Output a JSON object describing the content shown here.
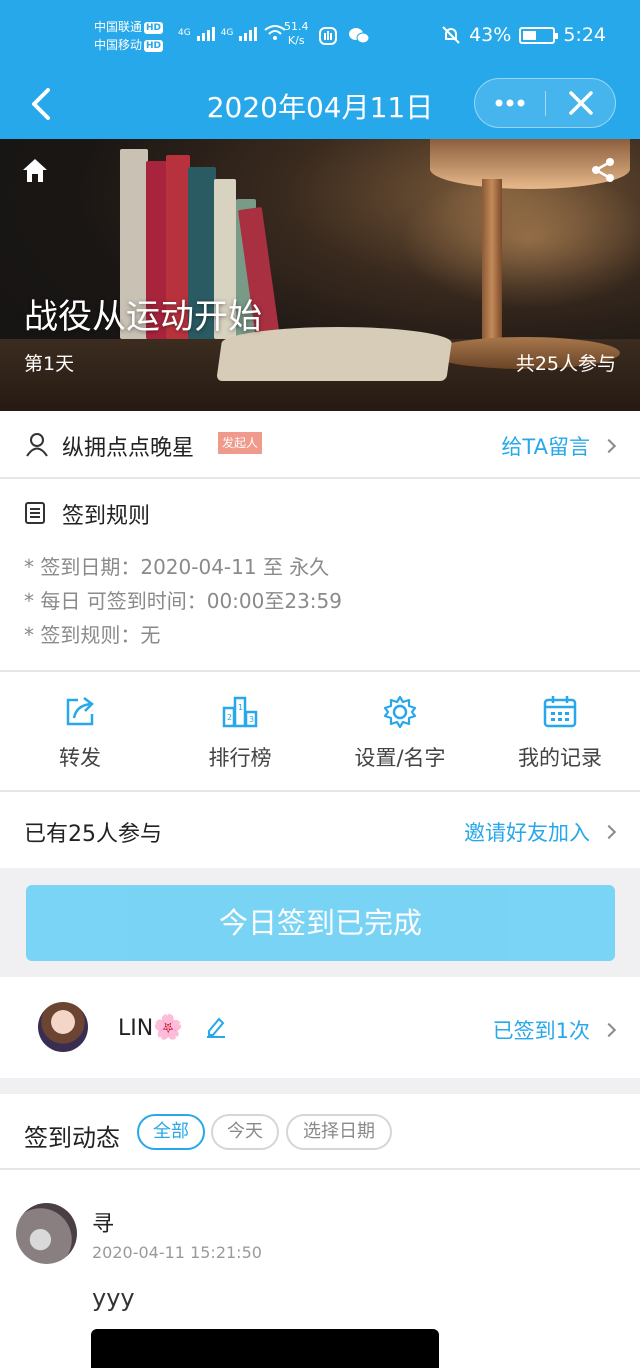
{
  "status_bar": {
    "carrier1": "中国联通",
    "carrier2": "中国移动",
    "hd": "HD",
    "net1": "4G",
    "net2": "4G",
    "speed_value": "51.4",
    "speed_unit": "K/s",
    "battery": "43%",
    "time": "5:24"
  },
  "nav": {
    "title": "2020年04月11日"
  },
  "banner": {
    "title": "战役从运动开始",
    "day": "第1天",
    "participants": "共25人参与"
  },
  "owner": {
    "name": "纵拥点点晚星",
    "badge": "发起人",
    "leave_message": "给TA留言"
  },
  "rules": {
    "title": "签到规则",
    "lines": [
      "* 签到日期：2020-04-11 至 永久",
      "* 每日 可签到时间：00:00至23:59",
      "* 签到规则：无"
    ]
  },
  "actions": [
    {
      "label": "转发",
      "icon": "share-out-icon"
    },
    {
      "label": "排行榜",
      "icon": "podium-icon"
    },
    {
      "label": "设置/名字",
      "icon": "gear-icon"
    },
    {
      "label": "我的记录",
      "icon": "calendar-icon"
    }
  ],
  "participants": {
    "text": "已有25人参与",
    "invite": "邀请好友加入"
  },
  "checkin_button": "今日签到已完成",
  "user": {
    "name": "LIN",
    "flower": "🌸",
    "signed": "已签到1次"
  },
  "dynamics": {
    "title": "签到动态",
    "filters": [
      "全部",
      "今天",
      "选择日期"
    ]
  },
  "post": {
    "name": "寻",
    "time": "2020-04-11 15:21:50",
    "text": "yyy"
  },
  "colors": {
    "accent": "#27a8ea",
    "button": "#72d2f6",
    "badge": "#ef9a8a"
  }
}
